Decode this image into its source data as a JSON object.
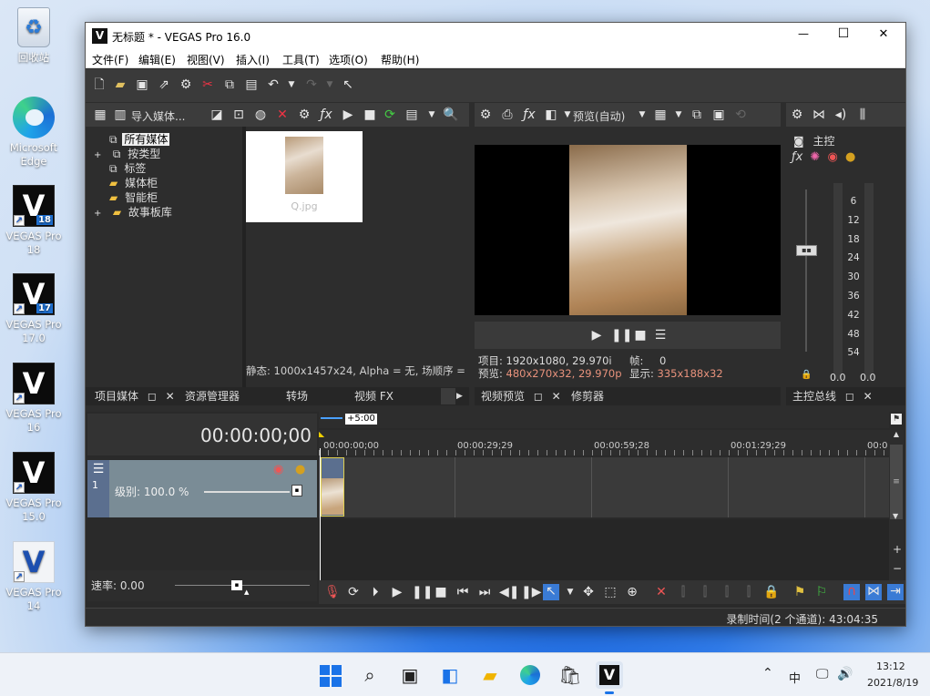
{
  "desktop": {
    "icons": [
      {
        "label": "回收站",
        "glyph": "♻",
        "type": "recycle"
      },
      {
        "label": "Microsoft Edge",
        "glyph": "e",
        "type": "edge"
      },
      {
        "label": "VEGAS Pro 18",
        "badge": "18",
        "type": "vegas"
      },
      {
        "label": "VEGAS Pro 17.0",
        "badge": "17",
        "type": "vegas"
      },
      {
        "label": "VEGAS Pro 16",
        "badge": "",
        "type": "vegas"
      },
      {
        "label": "VEGAS Pro 15.0",
        "badge": "",
        "type": "vegas"
      },
      {
        "label": "VEGAS Pro 14",
        "badge": "",
        "type": "vegas14"
      }
    ]
  },
  "window": {
    "logo": "V",
    "title": "无标题 * - VEGAS Pro 16.0",
    "controls": {
      "minimize": "—",
      "maximize": "☐",
      "close": "✕"
    },
    "menu": [
      "文件(F)",
      "编辑(E)",
      "视图(V)",
      "插入(I)",
      "工具(T)",
      "选项(O)",
      "帮助(H)"
    ]
  },
  "media_panel": {
    "import_label": "导入媒体...",
    "tree": [
      {
        "label": "所有媒体",
        "selected": true
      },
      {
        "label": "按类型",
        "expand": "+"
      },
      {
        "label": "标签"
      },
      {
        "label": "媒体柜"
      },
      {
        "label": "智能柜"
      },
      {
        "label": "故事板库",
        "expand": "+"
      }
    ],
    "thumb_name": "Q.jpg",
    "status": "静态: 1000x1457x24, Alpha = 无, 场顺序 = 无",
    "tabs": [
      "项目媒体",
      "资源管理器",
      "转场",
      "视频 FX"
    ]
  },
  "preview_panel": {
    "quality": "预览(自动)",
    "project_label": "项目:",
    "project_value": "1920x1080, 29.970i",
    "frame_label": "帧:",
    "frame_value": "0",
    "preview_label": "预览:",
    "preview_value": "480x270x32, 29.970p",
    "display_label": "显示:",
    "display_value": "335x188x32",
    "tabs": [
      "视频预览",
      "修剪器"
    ]
  },
  "master_panel": {
    "title": "主控",
    "scale": [
      "6",
      "12",
      "18",
      "24",
      "30",
      "36",
      "42",
      "48",
      "54"
    ],
    "levels": [
      "0.0",
      "0.0"
    ],
    "tab": "主控总线"
  },
  "timeline": {
    "timecode": "00:00:00;00",
    "loop_label": "+5:00",
    "ruler": [
      "00:00:00;00",
      "00:00:29;29",
      "00:00:59;28",
      "00:01:29;29",
      "00:0"
    ],
    "track_number": "1",
    "level_label": "级别: 100.0 %",
    "level_value": 1.0,
    "rate_label": "速率: 0.00",
    "status": "录制时间(2 个通道): 43:04:35"
  },
  "taskbar": {
    "ime": "中",
    "time": "13:12",
    "date": "2021/8/19"
  },
  "colors": {
    "accent": "#3a7bd5",
    "highlight_text": "#e8927c",
    "panel_bg": "#2d2d2d",
    "track_header": "#7a8c96"
  }
}
